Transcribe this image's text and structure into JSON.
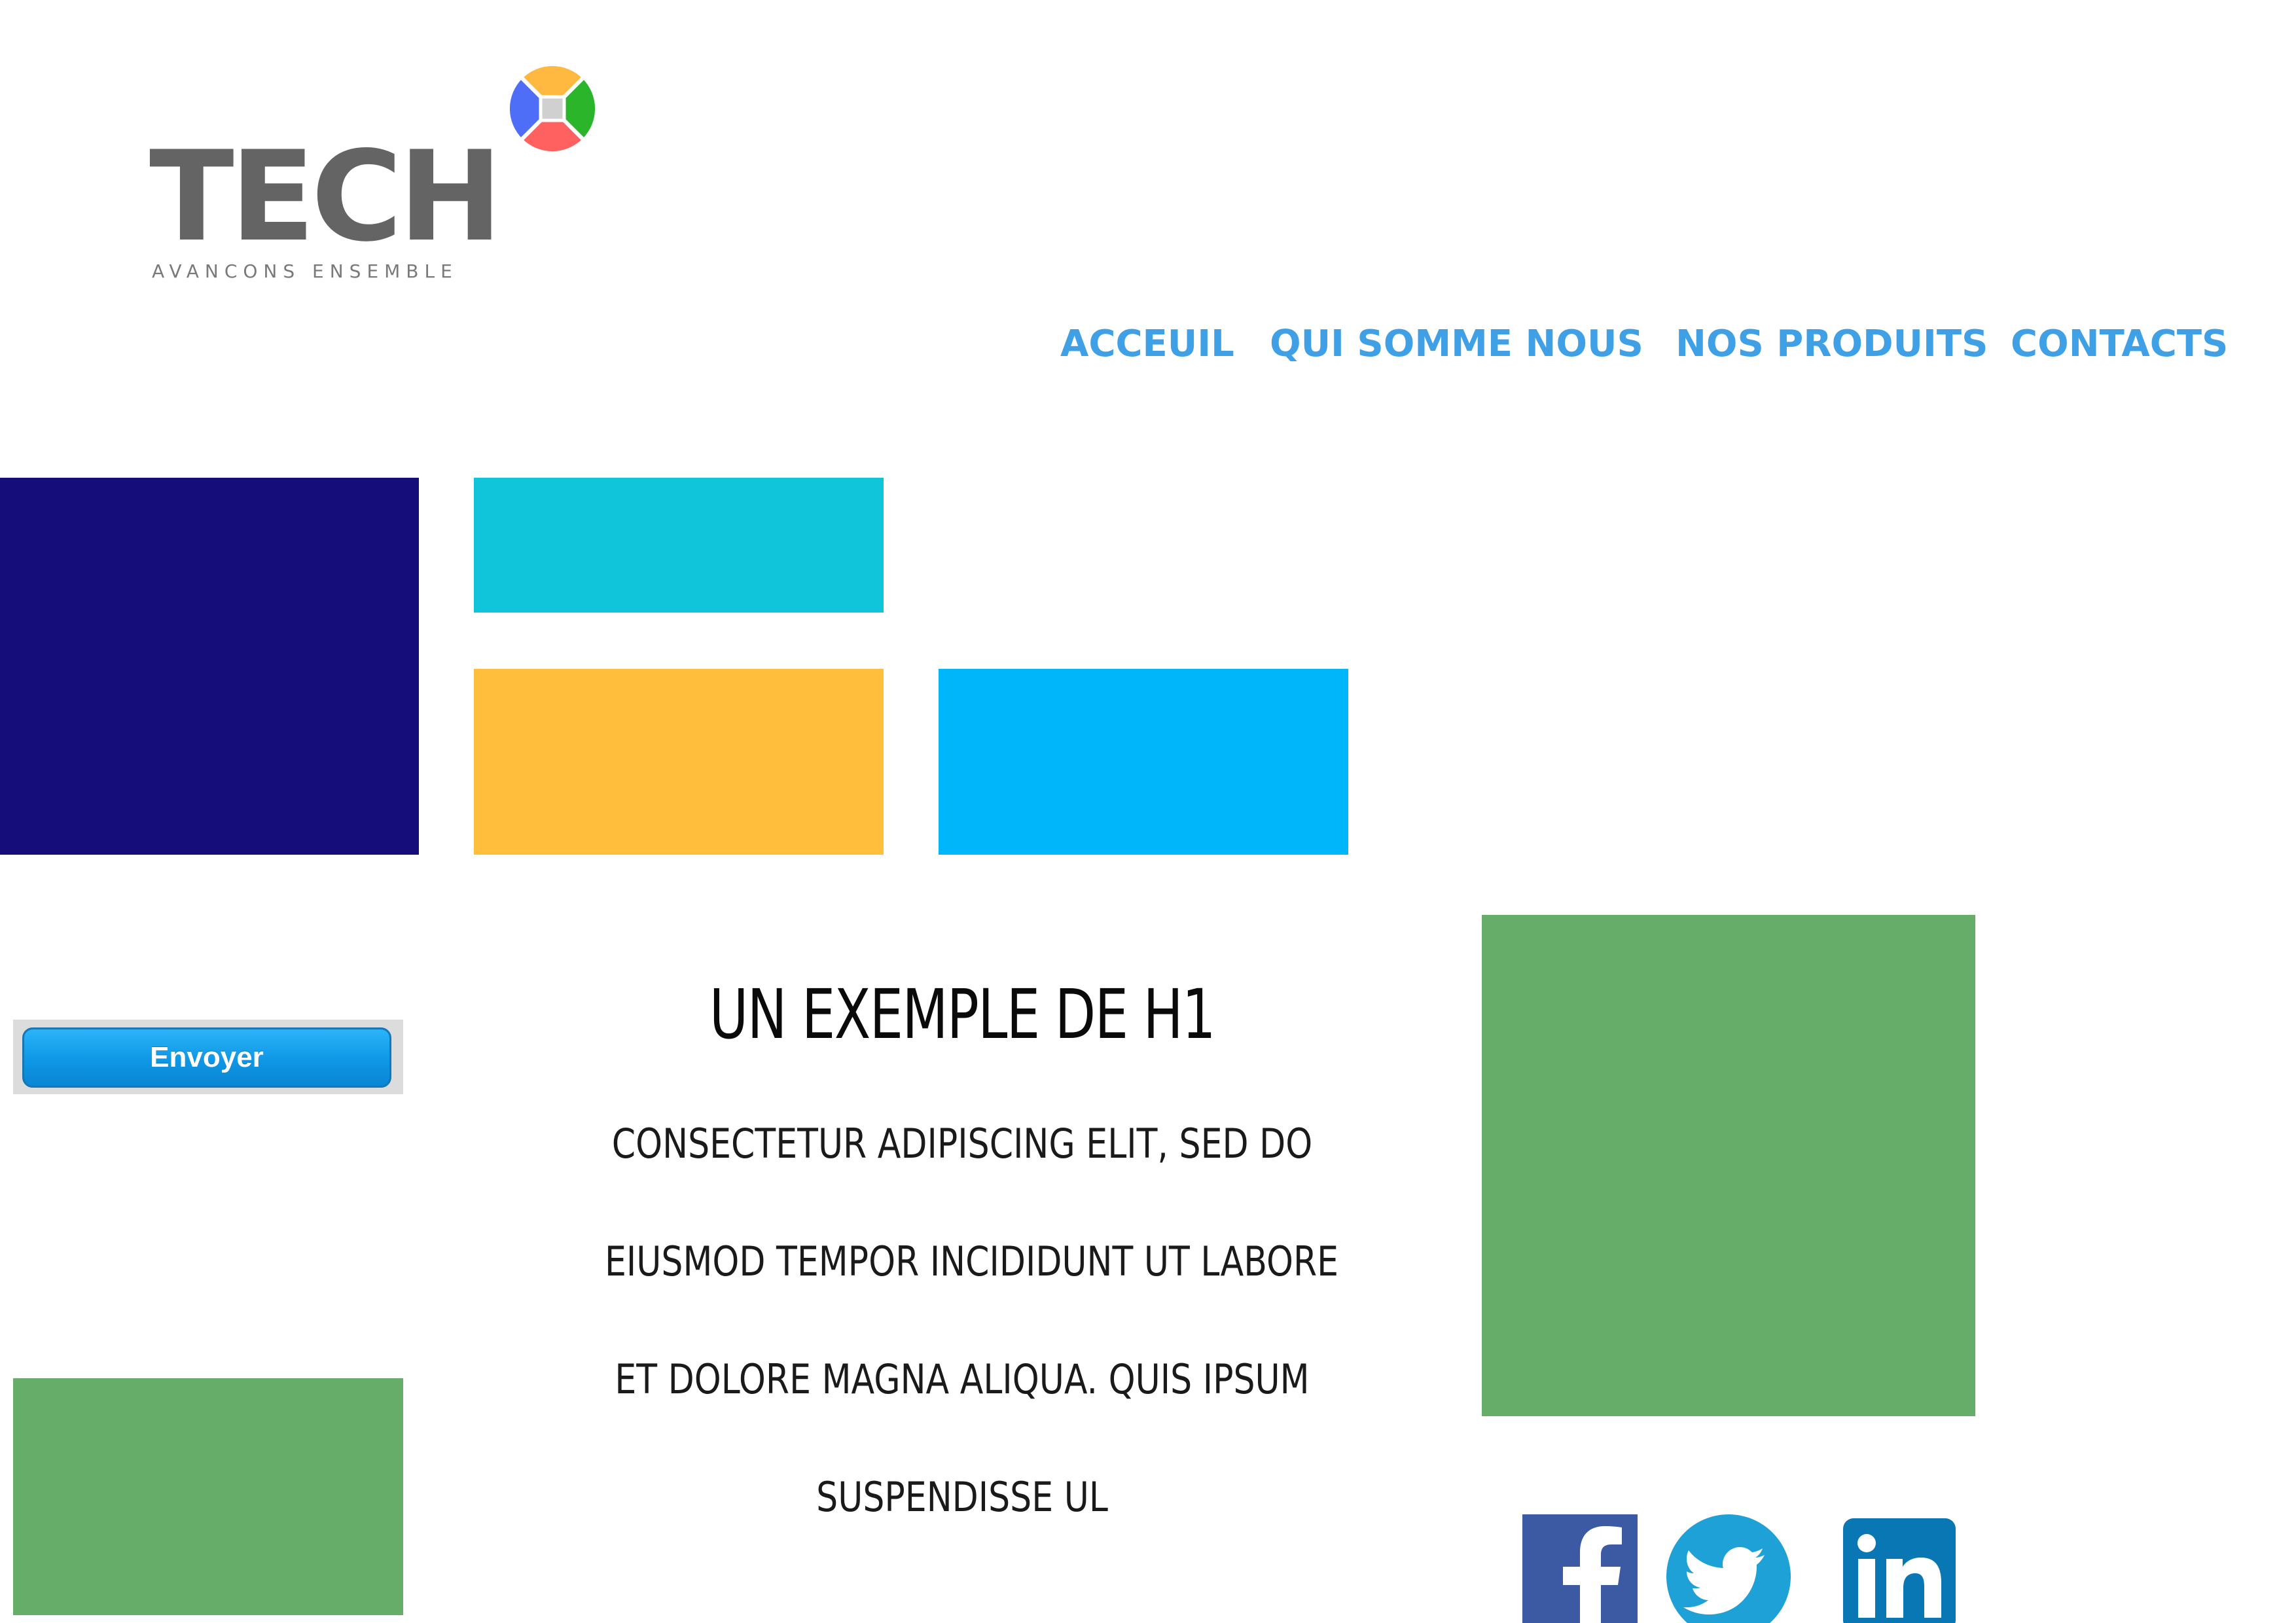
{
  "logo": {
    "word": "TECH",
    "tagline": "AVANCONS ENSEMBLE",
    "mark_icon": "quad-circle-logo-icon",
    "mark_colors": [
      "#ffb840",
      "#2ab52a",
      "#ff6060",
      "#4f6ef7",
      "#d0d0d0"
    ]
  },
  "nav": {
    "items": [
      {
        "label": "ACCEUIL"
      },
      {
        "label": "QUI SOMME NOUS"
      },
      {
        "label": "NOS PRODUITS"
      },
      {
        "label": "CONTACTS"
      }
    ],
    "color": "#40a0e6"
  },
  "tiles": {
    "navy": "#150d7a",
    "cyan": "#10c4da",
    "yellow": "#ffbe3c",
    "blue": "#00b6fb",
    "green": "#67ad6a"
  },
  "form": {
    "send_label": "Envoyer"
  },
  "content": {
    "heading": "UN EXEMPLE DE H1",
    "paragraph_lines": [
      "CONSECTETUR ADIPISCING ELIT, SED DO",
      "EIUSMOD TEMPOR INCIDIDUNT UT LABORE",
      "ET DOLORE MAGNA ALIQUA. QUIS IPSUM",
      "SUSPENDISSE UL"
    ]
  },
  "social": {
    "icons": [
      "facebook-icon",
      "twitter-icon",
      "linkedin-icon"
    ],
    "colors": {
      "facebook": "#3b5aa3",
      "twitter": "#1da1d6",
      "linkedin": "#0a77b5"
    }
  }
}
